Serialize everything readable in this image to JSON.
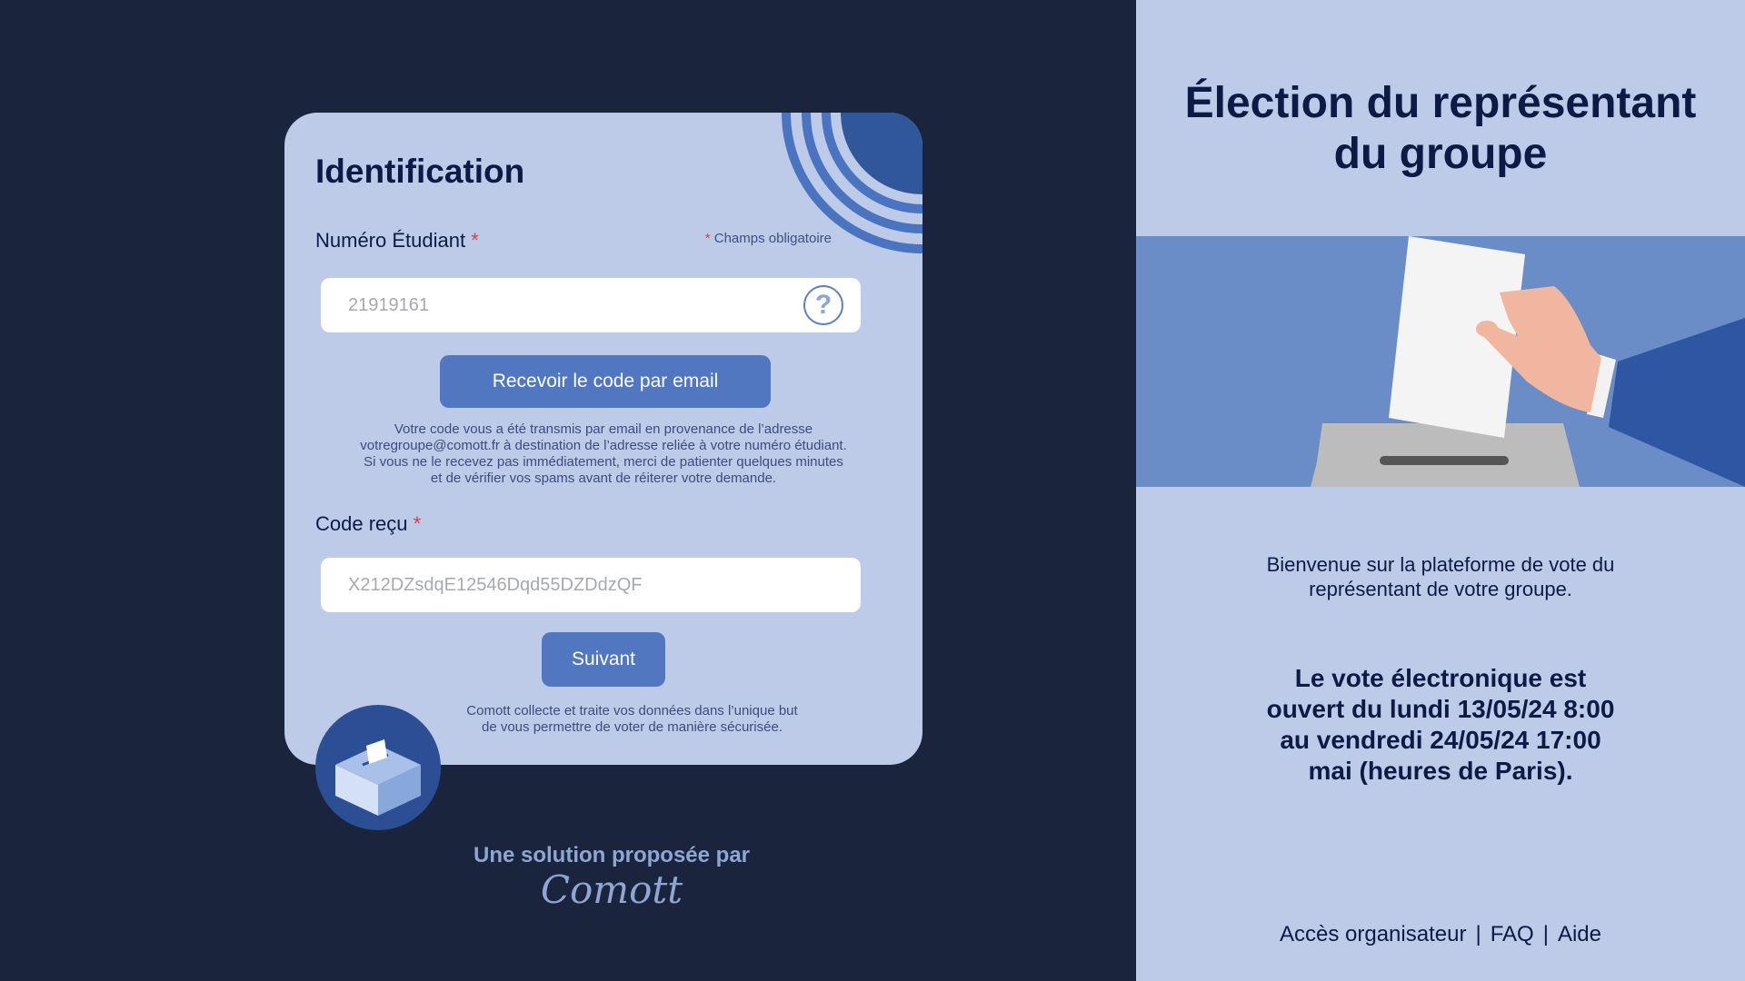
{
  "form": {
    "title": "Identification",
    "student_label": "Numéro Étudiant",
    "required_mark": "*",
    "required_note": "Champs obligatoire",
    "student_placeholder": "21919161",
    "help_glyph": "?",
    "send_code_button": "Recevoir le code par email",
    "code_info_lines": [
      "Votre code vous a été transmis par email en provenance de l’adresse",
      "votregroupe@comott.fr à destination de l’adresse reliée à votre numéro étudiant.",
      "Si vous ne le recevez pas immédiatement, merci de patienter quelques minutes",
      "et de vérifier vos spams avant de réiterer votre demande."
    ],
    "code_label": "Code reçu",
    "code_placeholder": "X212DZsdqE12546Dqd55DZDdzQF",
    "next_button": "Suivant",
    "privacy_lines": [
      "Comott collecte et traite vos données dans l’unique but",
      "de vous permettre de voter de manière sécurisée."
    ]
  },
  "branding": {
    "tagline": "Une solution proposée par",
    "name": "Comott"
  },
  "info": {
    "title_lines": [
      "Élection du représentant",
      "du groupe"
    ],
    "welcome_lines": [
      "Bienvenue sur la plateforme de vote du",
      "représentant de votre groupe."
    ],
    "dates_lines": [
      "Le vote électronique est",
      "ouvert du lundi 13/05/24 8:00",
      "au vendredi 24/05/24 17:00",
      "mai (heures de Paris)."
    ]
  },
  "footer": {
    "links": [
      "Accès organisateur",
      "FAQ",
      "Aide"
    ],
    "separator": "|"
  },
  "colors": {
    "background_dark": "#1a253d",
    "panel_light": "#bdcbe9",
    "accent": "#5077c0",
    "required": "#e23b3b"
  },
  "icons": [
    "question-icon",
    "ballot-box-icon",
    "voting-hand-illustration",
    "arc-decoration"
  ]
}
